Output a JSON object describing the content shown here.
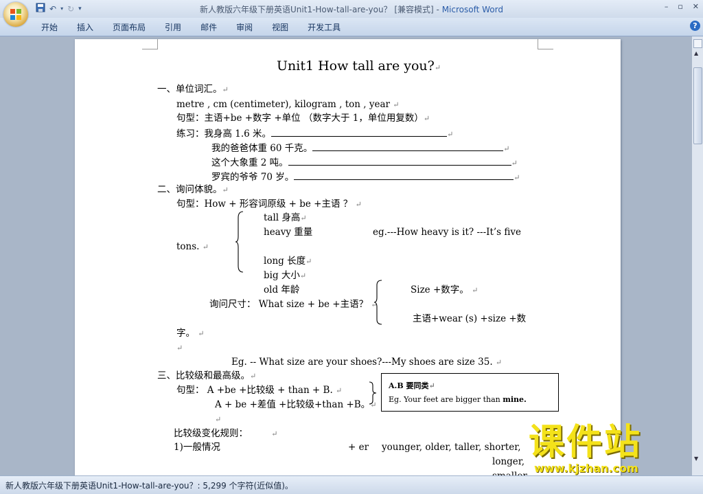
{
  "window": {
    "title_doc": "新人教版六年级下册英语Unit1-How-tall-are-you？ [兼容模式] - ",
    "title_app": "Microsoft Word",
    "minimize": "–",
    "restore": "▫",
    "close": "✕"
  },
  "ribbon": {
    "tabs": [
      "开始",
      "插入",
      "页面布局",
      "引用",
      "邮件",
      "审阅",
      "视图",
      "开发工具"
    ],
    "help": "?"
  },
  "doc": {
    "title": "Unit1 How tall are you?",
    "s1_heading": "一、单位词汇。",
    "s1_units": "metre ,    cm (centimeter),    kilogram ,    ton    ,    year",
    "s1_pattern": "句型：主语+be +数字  +单位 （数字大于 1，单位用复数）",
    "s1_practice_label": "练习：我身高 1.6 米。",
    "s1_ex2": "我的爸爸体重 60 千克。",
    "s1_ex3": "这个大象重 2 吨。",
    "s1_ex4": "罗宾的爷爷 70 岁。",
    "s2_heading": "二、询问体貌。",
    "s2_pattern": "句型：How +  形容词原级  + be +主语  ？",
    "s2_tall": "tall    身高",
    "s2_heavy": "heavy  重量",
    "s2_eg": "eg.---How heavy is it?    ---It’s five",
    "s2_tons": "tons.",
    "s2_long": "long    长度",
    "s2_big": "big      大小",
    "s2_old": "old      年龄",
    "s2_size_num": "Size +数字。",
    "s2_ask_size": "询问尺寸：  What size + be +主语？",
    "s2_wear": "主语+wear (s) +size +数",
    "s2_zi": "字。",
    "s2_example": "Eg. -- What size are your shoes?---My shoes are size 35.",
    "s3_heading": "三、比较级和最高级。",
    "s3_p1": "句型：  A +be +比较级  + than + B.",
    "s3_p2": "A + be +差值  +比较级+than +B。",
    "s3_box_title": "A.B  要同类",
    "s3_box_eg_pre": "Eg. Your feet are bigger  than ",
    "s3_box_eg_bold": "mine.",
    "s3_rules": "比较级变化规则：",
    "s3_rule1": "1)一般情况",
    "s3_er": "+ er",
    "s3_words1": "younger, older, taller, shorter,",
    "s3_words2": "longer,",
    "s3_words3": "smaller"
  },
  "status": {
    "text": "新人教版六年级下册英语Unit1-How-tall-are-you？: 5,299 个字符(近似值)。"
  },
  "watermark": {
    "main": "课件站",
    "url": "www.kjzhan.com"
  }
}
